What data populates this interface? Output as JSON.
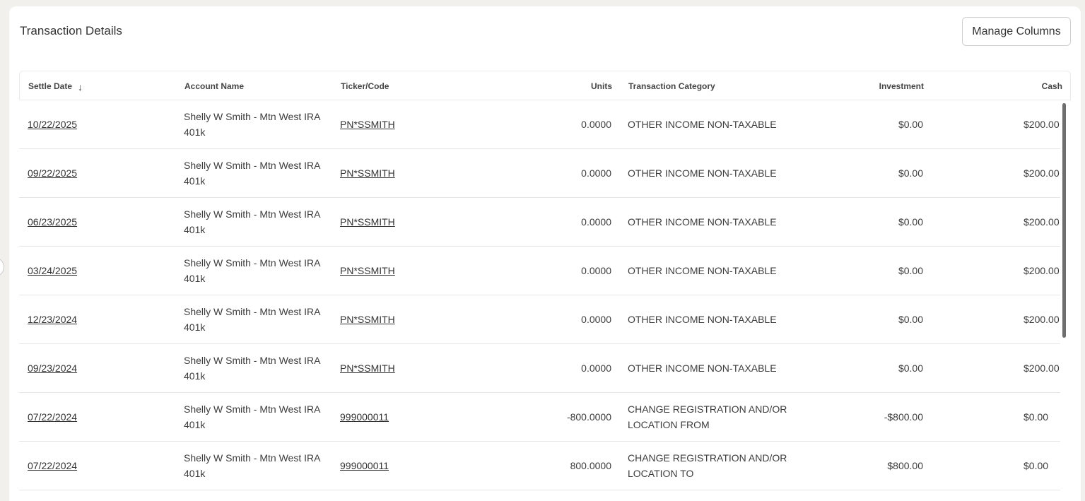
{
  "panel": {
    "title": "Transaction Details",
    "manage_columns_label": "Manage Columns"
  },
  "columns": {
    "settle_date": "Settle Date",
    "account_name": "Account Name",
    "ticker": "Ticker/Code",
    "units": "Units",
    "category": "Transaction Category",
    "investment": "Investment",
    "cash": "Cash"
  },
  "icons": {
    "sort": "arrow-down-icon",
    "side_handle": "collapse-handle-icon"
  },
  "colors": {
    "background": "#f1f0ed",
    "panel": "#ffffff",
    "text": "#3a3a3a",
    "scrollbar": "#6e6e6e"
  },
  "rows": [
    {
      "settle_date": "10/22/2025",
      "account_name": "Shelly W Smith - Mtn West IRA 401k",
      "ticker": "PN*SSMITH",
      "units": "0.0000",
      "category": "OTHER INCOME NON-TAXABLE",
      "investment": "$0.00",
      "cash": "$200.00"
    },
    {
      "settle_date": "09/22/2025",
      "account_name": "Shelly W Smith - Mtn West IRA 401k",
      "ticker": "PN*SSMITH",
      "units": "0.0000",
      "category": "OTHER INCOME NON-TAXABLE",
      "investment": "$0.00",
      "cash": "$200.00"
    },
    {
      "settle_date": "06/23/2025",
      "account_name": "Shelly W Smith - Mtn West IRA 401k",
      "ticker": "PN*SSMITH",
      "units": "0.0000",
      "category": "OTHER INCOME NON-TAXABLE",
      "investment": "$0.00",
      "cash": "$200.00"
    },
    {
      "settle_date": "03/24/2025",
      "account_name": "Shelly W Smith - Mtn West IRA 401k",
      "ticker": "PN*SSMITH",
      "units": "0.0000",
      "category": "OTHER INCOME NON-TAXABLE",
      "investment": "$0.00",
      "cash": "$200.00"
    },
    {
      "settle_date": "12/23/2024",
      "account_name": "Shelly W Smith - Mtn West IRA 401k",
      "ticker": "PN*SSMITH",
      "units": "0.0000",
      "category": "OTHER INCOME NON-TAXABLE",
      "investment": "$0.00",
      "cash": "$200.00"
    },
    {
      "settle_date": "09/23/2024",
      "account_name": "Shelly W Smith - Mtn West IRA 401k",
      "ticker": "PN*SSMITH",
      "units": "0.0000",
      "category": "OTHER INCOME NON-TAXABLE",
      "investment": "$0.00",
      "cash": "$200.00"
    },
    {
      "settle_date": "07/22/2024",
      "account_name": "Shelly W Smith - Mtn West IRA 401k",
      "ticker": "999000011",
      "units": "-800.0000",
      "category": "CHANGE REGISTRATION AND/OR LOCATION FROM",
      "investment": "-$800.00",
      "cash": "$0.00"
    },
    {
      "settle_date": "07/22/2024",
      "account_name": "Shelly W Smith - Mtn West IRA 401k",
      "ticker": "999000011",
      "units": "800.0000",
      "category": "CHANGE REGISTRATION AND/OR LOCATION TO",
      "investment": "$800.00",
      "cash": "$0.00"
    }
  ]
}
